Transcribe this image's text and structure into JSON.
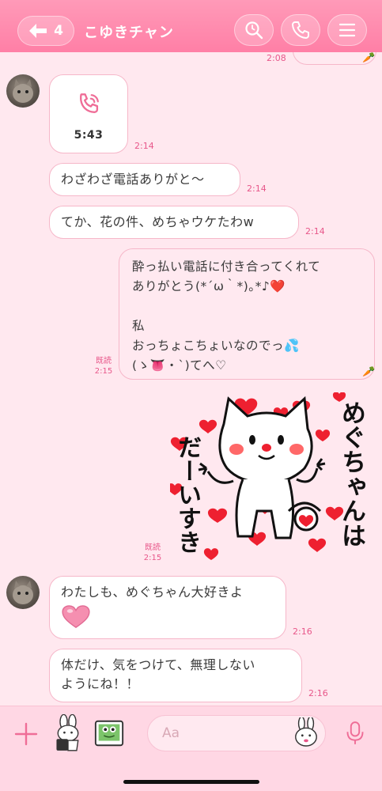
{
  "header": {
    "back_count": "4",
    "title": "こゆきチャン",
    "icons": [
      "back-arrow-icon",
      "search-icon",
      "phone-icon",
      "menu-icon"
    ]
  },
  "messages": [
    {
      "side": "right",
      "partial_time": "2:08"
    },
    {
      "side": "left",
      "type": "call",
      "duration": "5:43",
      "time": "2:14"
    },
    {
      "side": "left",
      "text": "わざわざ電話ありがと〜",
      "time": "2:14"
    },
    {
      "side": "left",
      "text": "てか、花の件、めちゃウケたわw",
      "time": "2:14"
    },
    {
      "side": "right",
      "lines": [
        "酔っ払い電話に付き合ってくれて",
        "ありがとう(*´ω｀*)｡*♪",
        "",
        "私",
        "おっちょこちょいなのでっ",
        "(ゝ",
        "・`)てへ♡"
      ],
      "read": "既読",
      "time": "2:15"
    },
    {
      "side": "right",
      "type": "sticker",
      "sticker_text_left": "だーいすき",
      "sticker_text_right": "めぐちゃんは",
      "read": "既読",
      "time": "2:15"
    },
    {
      "side": "left",
      "text": "わたしも、めぐちゃん大好きよ",
      "emoji": "heart",
      "time": "2:16"
    },
    {
      "side": "left",
      "lines": [
        "体だけ、気をつけて、無理しない",
        "ようにね！！"
      ],
      "time": "2:16"
    }
  ],
  "footer": {
    "input_placeholder": "Aa",
    "icons": [
      "plus-icon",
      "sticker-bunny-icon",
      "photo-frog-icon",
      "emoji-bunny-icon",
      "microphone-icon"
    ]
  },
  "colors": {
    "accent": "#ff7fa6",
    "background": "#ffe8ef",
    "time_text": "#e8578a"
  }
}
